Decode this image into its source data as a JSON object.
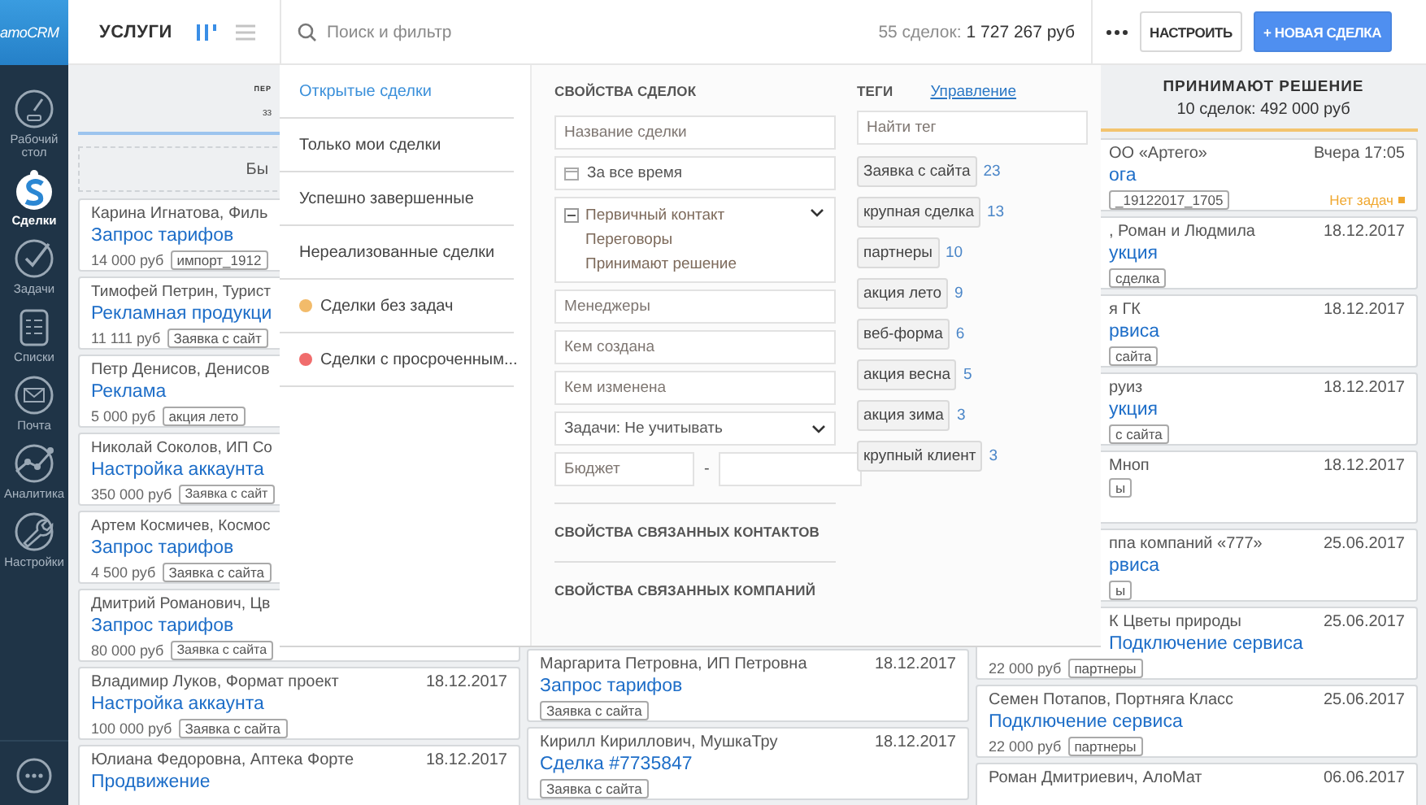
{
  "sidebar": {
    "logo": "amoCRM",
    "items": [
      {
        "label": "Рабочий стол",
        "selected": false
      },
      {
        "label": "Сделки",
        "selected": true
      },
      {
        "label": "Задачи",
        "selected": false
      },
      {
        "label": "Списки",
        "selected": false
      },
      {
        "label": "Почта",
        "selected": false
      },
      {
        "label": "Аналитика",
        "selected": false
      },
      {
        "label": "Настройки",
        "selected": false
      }
    ]
  },
  "topbar": {
    "title": "УСЛУГИ",
    "views": [
      {
        "kind": "pipeline",
        "selected": true
      },
      {
        "kind": "list",
        "selected": false
      }
    ],
    "search": {
      "placeholder": "Поиск и фильтр"
    },
    "summary": {
      "count": "55 сделок:",
      "total": "1 727 267 руб"
    },
    "buttons": [
      {
        "label": "НАСТРОИТЬ",
        "kind": "secondary"
      },
      {
        "label": "+ НОВАЯ СДЕЛКА",
        "kind": "primary"
      }
    ]
  },
  "board": {
    "columns": [
      {
        "title": "ПЕР",
        "subtitle": "33",
        "color": "#9cc4ee",
        "quick_add": "Бы",
        "cards": [
          {
            "name": "Карина Игнатова, Филь",
            "title": "Запрос тарифов",
            "price": "14 000 руб",
            "tags": [
              "импорт_1912"
            ]
          },
          {
            "name": "Тимофей Петрин, Турист",
            "title": "Рекламная продукци",
            "price": "11 111 руб",
            "tags": [
              "Заявка с сайт"
            ]
          },
          {
            "name": "Петр Денисов, Денисов",
            "title": "Реклама",
            "price": "5 000 руб",
            "tags": [
              "акция лето"
            ]
          },
          {
            "name": "Николай Соколов, ИП Со",
            "title": "Настройка аккаунта",
            "price": "350 000 руб",
            "tags": [
              "Заявка с сайт"
            ]
          },
          {
            "name": "Артем Космичев, Космос",
            "title": "Запрос тарифов",
            "price": "4 500 руб",
            "tags": [
              "Заявка с сайта"
            ]
          },
          {
            "name": "Дмитрий Романович, Цв",
            "title": "Запрос тарифов",
            "price": "80 000 руб",
            "tags": [
              "Заявка с сайта"
            ]
          },
          {
            "name": "Владимир Луков, Формат проект",
            "date": "18.12.2017",
            "title": "Настройка аккаунта",
            "price": "100 000 руб",
            "tags": [
              "Заявка с сайта"
            ]
          },
          {
            "name": "Юлиана Федоровна, Аптека Форте",
            "date": "18.12.2017",
            "title": "Продвижение"
          }
        ]
      },
      {
        "cards": [
          {
            "name": "Маргарита Петровна, ИП Петровна",
            "date": "18.12.2017",
            "title": "Запрос тарифов",
            "tags": [
              "Заявка с сайта"
            ]
          },
          {
            "name": "Кирилл Кириллович, МушкаТру",
            "date": "18.12.2017",
            "title": "Сделка #7735847",
            "tags": [
              "Заявка с сайта"
            ]
          }
        ]
      },
      {
        "title": "ПРИНИМАЮТ РЕШЕНИЕ",
        "subtitle": "10 сделок: 492 000 руб",
        "color": "#f3c46f",
        "cards": [
          {
            "name": "ОО «Артего»",
            "date": "Вчера 17:05",
            "title": "ога",
            "tags": [
              "_19122017_1705"
            ],
            "status": "Нет задач"
          },
          {
            "name": ", Роман и Людмила",
            "date": "18.12.2017",
            "title": "укция",
            "tags": [
              "сделка"
            ]
          },
          {
            "name": "я ГК",
            "date": "18.12.2017",
            "title": "рвиса",
            "tags": [
              "сайта"
            ]
          },
          {
            "name": "руиз",
            "date": "18.12.2017",
            "title": "укция",
            "tags": [
              "с сайта"
            ]
          },
          {
            "name": "Мноп",
            "date": "18.12.2017",
            "tags": [
              "ы"
            ]
          },
          {
            "name": "ппа компаний «777»",
            "date": "25.06.2017",
            "title": "рвиса",
            "tags": [
              "ы"
            ]
          },
          {
            "name": "К Цветы природы",
            "date": "25.06.2017",
            "title": "Подключение сервиса",
            "price": "22 000 руб",
            "tags": [
              "партнеры"
            ]
          },
          {
            "name": "Семен Потапов, Портняга Класс",
            "date": "25.06.2017",
            "title": "Подключение сервиса",
            "price": "22 000 руб",
            "tags": [
              "партнеры"
            ]
          },
          {
            "name": "Роман Дмитриевич, АлоМат",
            "date": "06.06.2017"
          }
        ]
      }
    ]
  },
  "filter": {
    "presets": [
      {
        "label": "Открытые сделки",
        "selected": true
      },
      {
        "label": "Только мои сделки",
        "selected": false
      },
      {
        "label": "Успешно завершенные",
        "selected": false
      },
      {
        "label": "Нереализованные сделки",
        "selected": false
      },
      {
        "label": "Сделки без задач",
        "selected": false,
        "color": "#f2bb6a"
      },
      {
        "label": "Сделки с просроченным...",
        "selected": false,
        "color": "#f06c6c"
      }
    ],
    "properties": {
      "title": "СВОЙСТВА СДЕЛОК",
      "fields": [
        {
          "kind": "text",
          "placeholder": "Название сделки"
        },
        {
          "kind": "date",
          "value": "За все время"
        },
        {
          "kind": "stages",
          "items": [
            "Первичный контакт",
            "Переговоры",
            "Принимают решение"
          ]
        },
        {
          "kind": "text",
          "placeholder": "Менеджеры"
        },
        {
          "kind": "text",
          "placeholder": "Кем создана"
        },
        {
          "kind": "text",
          "placeholder": "Кем изменена"
        },
        {
          "kind": "select",
          "value": "Задачи: Не учитывать"
        },
        {
          "kind": "range",
          "placeholder": "Бюджет",
          "separator": "-"
        }
      ],
      "sections": [
        "СВОЙСТВА СВЯЗАННЫХ КОНТАКТОВ",
        "СВОЙСТВА СВЯЗАННЫХ КОМПАНИЙ"
      ]
    },
    "tags": {
      "title": "ТЕГИ",
      "manage": "Управление",
      "search": {
        "placeholder": "Найти тег"
      },
      "items": [
        {
          "label": "Заявка с сайта",
          "count": "23"
        },
        {
          "label": "крупная сделка",
          "count": "13"
        },
        {
          "label": "партнеры",
          "count": "10"
        },
        {
          "label": "акция лето",
          "count": "9"
        },
        {
          "label": "веб-форма",
          "count": "6"
        },
        {
          "label": "акция весна",
          "count": "5"
        },
        {
          "label": "акция зима",
          "count": "3"
        },
        {
          "label": "крупный клиент",
          "count": "3"
        }
      ]
    }
  }
}
